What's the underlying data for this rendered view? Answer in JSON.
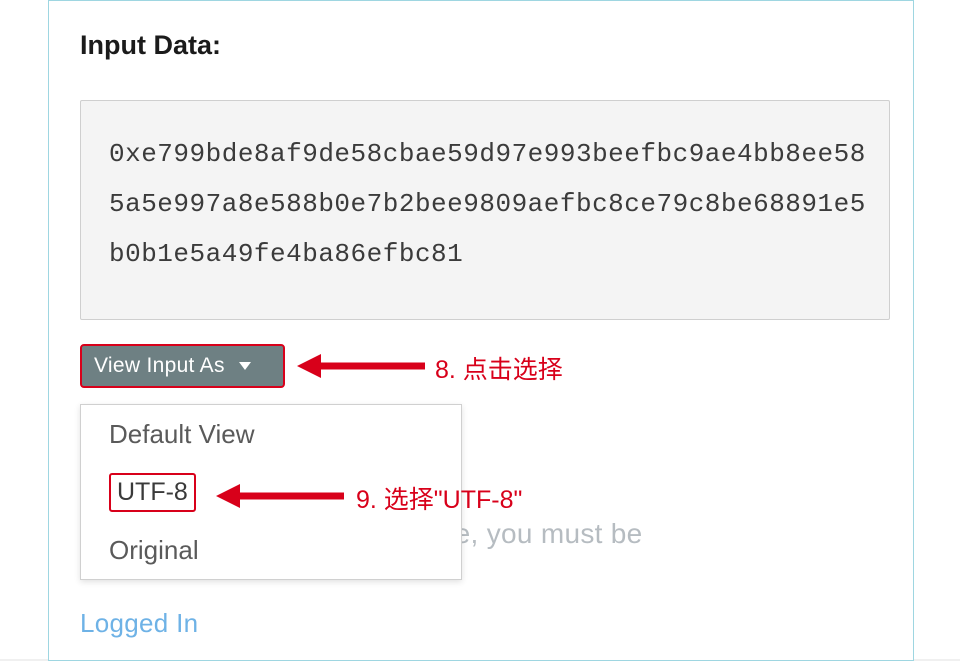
{
  "heading": "Input Data:",
  "hexdata": "0xe799bde8af9de58cbae59d97e993beefbc9ae4bb8ee585a5e997a8e588b0e7b2bee9809aefbc8ce79c8be68891e5b0b1e5a49fe4ba86efbc81",
  "dropdown": {
    "button_label": "View Input As",
    "options": {
      "default": "Default View",
      "utf8": "UTF-8",
      "original": "Original"
    }
  },
  "background_text_right": "e Feature, you must be",
  "background_text_blue": "Logged In",
  "annotations": {
    "step8": "8. 点击选择",
    "step9": "9. 选择\"UTF-8\""
  }
}
